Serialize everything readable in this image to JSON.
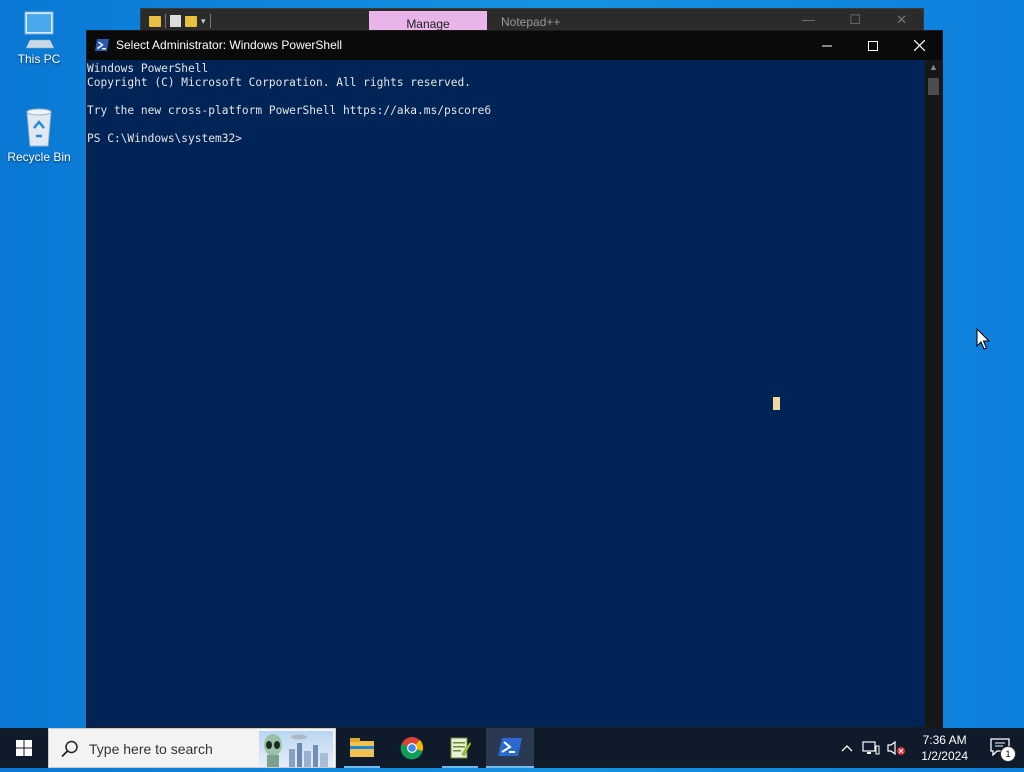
{
  "desktop": {
    "icons": [
      {
        "label": "This PC"
      },
      {
        "label": "Recycle Bin"
      }
    ]
  },
  "background_window": {
    "ribbon_tab": "Manage",
    "title": "Notepad++"
  },
  "powershell": {
    "title": "Select Administrator: Windows PowerShell",
    "lines": [
      "Windows PowerShell",
      "Copyright (C) Microsoft Corporation. All rights reserved.",
      "",
      "Try the new cross-platform PowerShell https://aka.ms/pscore6",
      "",
      "PS C:\\Windows\\system32>"
    ],
    "colors": {
      "background": "#012456",
      "text": "#e5e5e5"
    }
  },
  "taskbar": {
    "search_placeholder": "Type here to search",
    "apps": [
      {
        "icon": "file-explorer-icon"
      },
      {
        "icon": "chrome-icon"
      },
      {
        "icon": "notepad-plus-plus-icon"
      },
      {
        "icon": "powershell-icon",
        "active": true
      }
    ],
    "clock": {
      "time": "7:36 AM",
      "date": "1/2/2024"
    },
    "notification_count": "1"
  }
}
